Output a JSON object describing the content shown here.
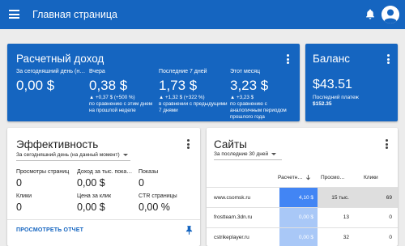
{
  "header": {
    "title": "Главная страница",
    "brand_color": "#1565c0"
  },
  "revenue": {
    "title": "Расчетный доход",
    "columns": [
      {
        "label": "За сегодняшний день (н…",
        "value": "0,00 $",
        "delta": "",
        "note": ""
      },
      {
        "label": "Вчера",
        "value": "0,38 $",
        "delta": "▲ +0,37 $ (+500 %)",
        "note": "по сравнению с этим днем на прошлой неделе"
      },
      {
        "label": "Последние 7 дней",
        "value": "1,73 $",
        "delta": "▲ +1,32 $ (+322 %)",
        "note": "в сравнении с предыдущими 7 днями"
      },
      {
        "label": "Этот месяц",
        "value": "3,23 $",
        "delta": "▲ +3,23 $",
        "note": "по сравнению с аналогичным периодом прошлого года"
      }
    ]
  },
  "balance": {
    "title": "Баланс",
    "value": "$43.51",
    "last_payment_label": "Последний платеж",
    "last_payment_value": "$152.35"
  },
  "efficiency": {
    "title": "Эффективность",
    "period": "За сегодняшний день (на данный момент)",
    "metrics": [
      {
        "label": "Просмотры страниц",
        "value": "0"
      },
      {
        "label": "Доход за тыс. пока…",
        "value": "0,00 $"
      },
      {
        "label": "Показы",
        "value": "0"
      },
      {
        "label": "Клики",
        "value": "0"
      },
      {
        "label": "Цена за клик",
        "value": "0,00 $"
      },
      {
        "label": "CTR страницы",
        "value": "0,00 %"
      }
    ],
    "report_link": "ПРОСМОТРЕТЬ ОТЧЕТ"
  },
  "sites": {
    "title": "Сайты",
    "period": "За последние 30 дней",
    "columns": [
      "Расчетн…",
      "Просмо…",
      "Клики"
    ],
    "rows": [
      {
        "site": "www.csomsk.ru",
        "revenue": "4,10 $",
        "views": "15 тыс.",
        "clicks": "69"
      },
      {
        "site": "frostteam.3dn.ru",
        "revenue": "0,00 $",
        "views": "13",
        "clicks": "0"
      },
      {
        "site": "cstrikeplayer.ru",
        "revenue": "0,00 $",
        "views": "32",
        "clicks": "0"
      }
    ]
  }
}
